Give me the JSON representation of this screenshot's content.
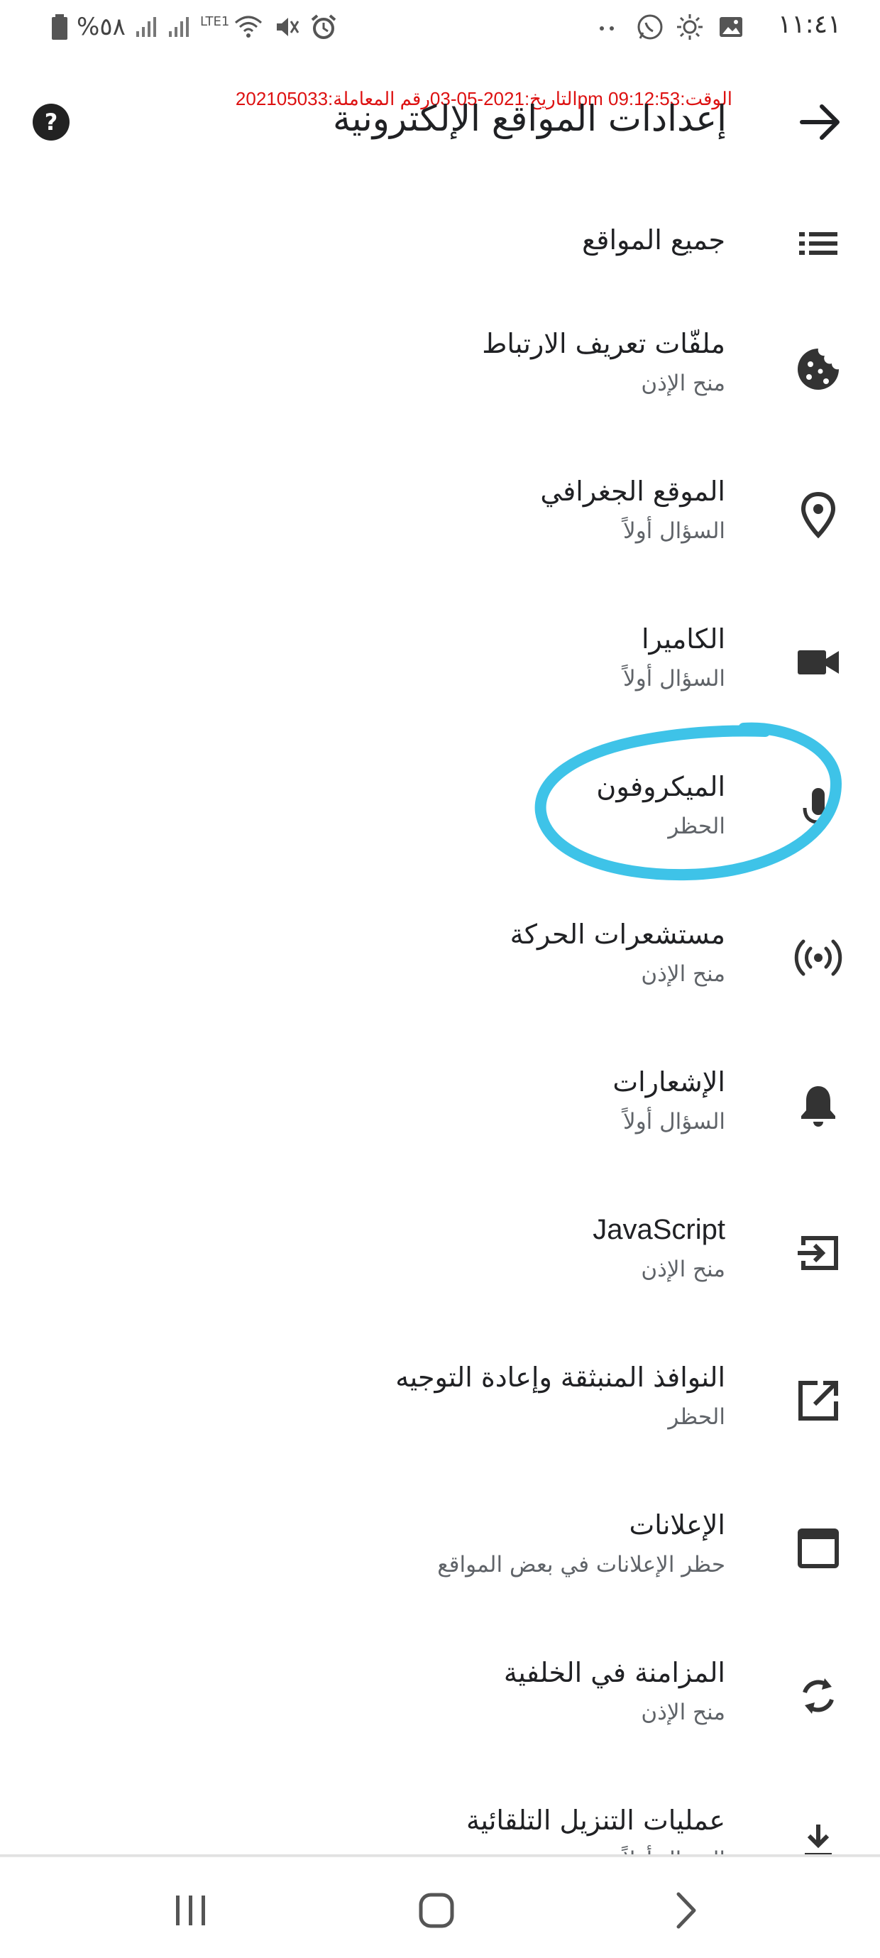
{
  "status_bar": {
    "time": "١١:٤١",
    "battery": "%٥٨",
    "network_label": "LTE1",
    "icons": [
      "image-icon",
      "settings-sun-icon",
      "whatsapp-icon",
      "dots-icon",
      "alarm-icon",
      "mute-icon",
      "wifi-icon",
      "signal-icon",
      "signal-icon",
      "battery-icon"
    ]
  },
  "watermark": "الوقت:09:12:53 pmالتاريخ:2021-05-03رقم المعاملة:202105033",
  "header": {
    "title": "إعدادات المواقع الإلكترونية",
    "back_icon": "arrow-right-icon",
    "help_icon": "help-circle-icon"
  },
  "settings": [
    {
      "id": "all-sites",
      "title": "جميع المواقع",
      "subtitle": "",
      "icon": "list-icon"
    },
    {
      "id": "cookies",
      "title": "ملفّات تعريف الارتباط",
      "subtitle": "منح الإذن",
      "icon": "cookie-icon"
    },
    {
      "id": "location",
      "title": "الموقع الجغرافي",
      "subtitle": "السؤال أولاً",
      "icon": "location-pin-icon"
    },
    {
      "id": "camera",
      "title": "الكاميرا",
      "subtitle": "السؤال أولاً",
      "icon": "video-camera-icon"
    },
    {
      "id": "microphone",
      "title": "الميكروفون",
      "subtitle": "الحظر",
      "icon": "microphone-icon"
    },
    {
      "id": "motion-sensors",
      "title": "مستشعرات الحركة",
      "subtitle": "منح الإذن",
      "icon": "sensors-icon"
    },
    {
      "id": "notifications",
      "title": "الإشعارات",
      "subtitle": "السؤال أولاً",
      "icon": "bell-icon"
    },
    {
      "id": "javascript",
      "title": "JavaScript",
      "subtitle": "منح الإذن",
      "icon": "input-arrow-icon"
    },
    {
      "id": "popups",
      "title": "النوافذ المنبثقة وإعادة التوجيه",
      "subtitle": "الحظر",
      "icon": "open-external-icon"
    },
    {
      "id": "ads",
      "title": "الإعلانات",
      "subtitle": "حظر الإعلانات في بعض المواقع",
      "icon": "window-icon"
    },
    {
      "id": "background-sync",
      "title": "المزامنة في الخلفية",
      "subtitle": "منح الإذن",
      "icon": "sync-icon"
    },
    {
      "id": "auto-downloads",
      "title": "عمليات التنزيل التلقائية",
      "subtitle": "السؤال أولاً",
      "icon": "download-icon"
    }
  ],
  "nav_bar": {
    "recents_icon": "recents-icon",
    "home_icon": "home-icon",
    "back_icon": "chevron-back-icon"
  },
  "colors": {
    "annotation": "#3ec3e8",
    "watermark": "#dd1111",
    "icon": "#333333"
  }
}
